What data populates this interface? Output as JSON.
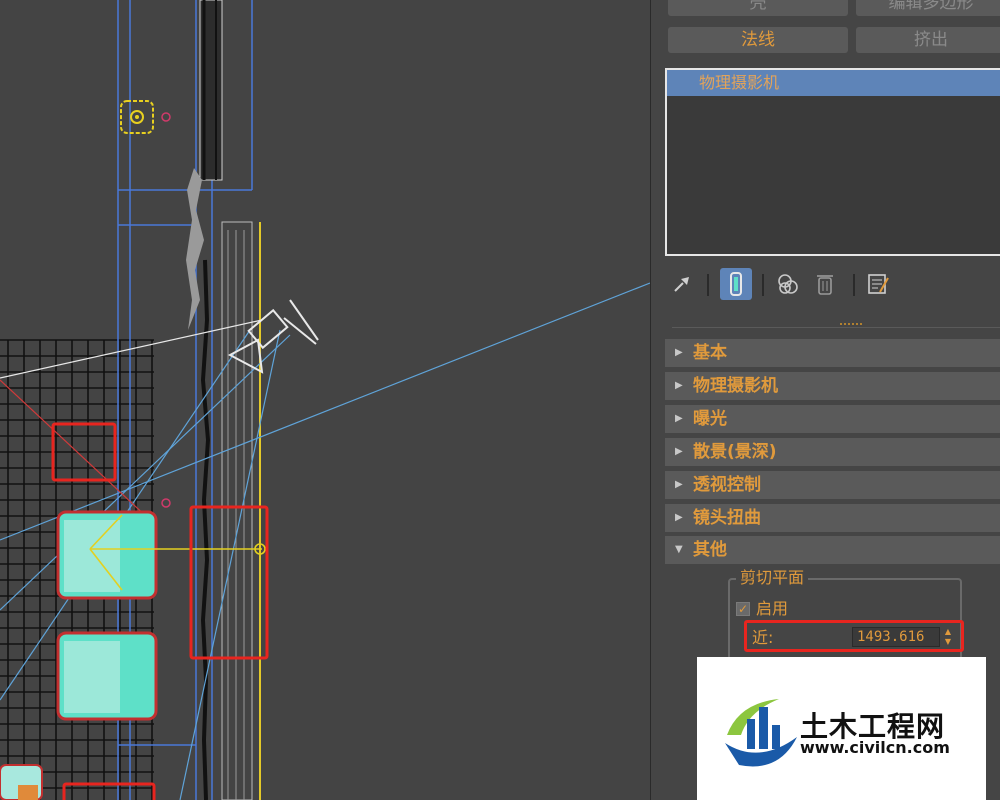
{
  "panel": {
    "top_buttons": [
      "壳",
      "编辑多边形",
      "法线",
      "挤出"
    ],
    "modifier_stack": {
      "selected": "物理摄影机"
    },
    "toolbar_icons": [
      "pin-icon",
      "show-end-result-icon",
      "make-unique-icon",
      "remove-modifier-icon",
      "configure-modifier-sets-icon"
    ],
    "rollouts": [
      {
        "label": "基本",
        "expanded": false
      },
      {
        "label": "物理摄影机",
        "expanded": false
      },
      {
        "label": "曝光",
        "expanded": false
      },
      {
        "label": "散景(景深)",
        "expanded": false
      },
      {
        "label": "透视控制",
        "expanded": false
      },
      {
        "label": "镜头扭曲",
        "expanded": false
      },
      {
        "label": "其他",
        "expanded": true
      }
    ],
    "clipping": {
      "group_title": "剪切平面",
      "enable_label": "启用",
      "enable_checked": true,
      "near_label": "近:",
      "near_value": "1493.616"
    }
  },
  "watermark": {
    "title": "土木工程网",
    "url": "www.civilcn.com"
  },
  "colors": {
    "accent_orange": "#e09a3c",
    "highlight_red": "#e8251f",
    "selection_blue": "#5e84b8",
    "wire_cyan": "#5ee0c8"
  }
}
